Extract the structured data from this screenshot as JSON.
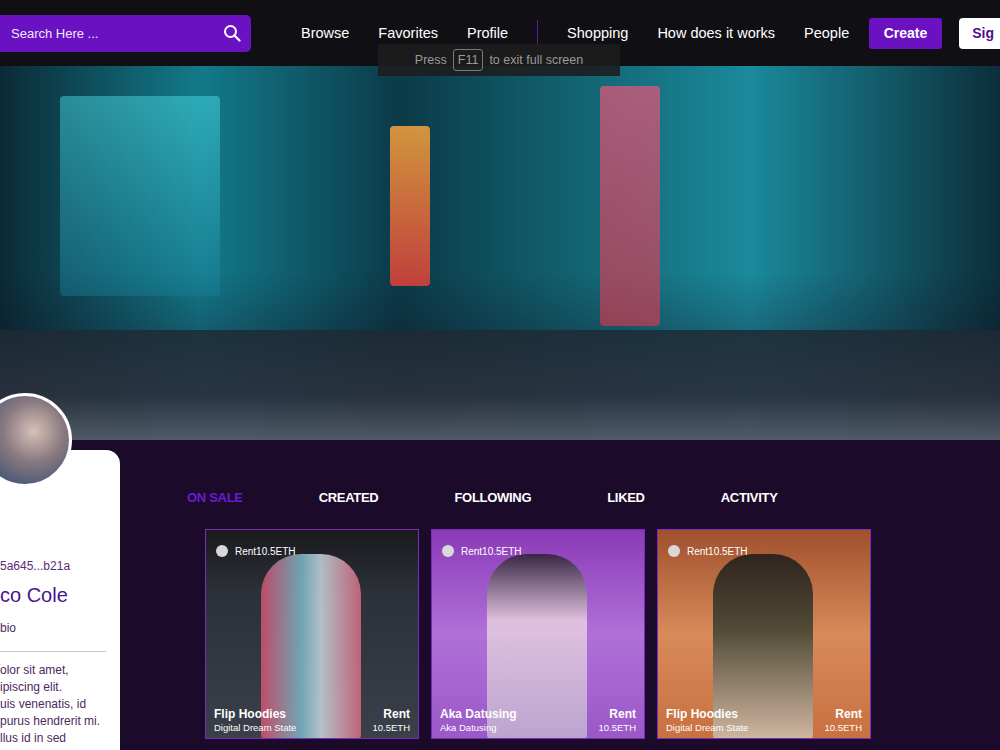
{
  "search": {
    "placeholder": "Search Here ..."
  },
  "nav": {
    "primary": [
      "Browse",
      "Favorites",
      "Profile"
    ],
    "secondary": [
      "Shopping",
      "How does it works",
      "People"
    ]
  },
  "buttons": {
    "create": "Create",
    "sign": "Sig"
  },
  "fullscreen_notice": {
    "before": "Press",
    "key": "F11",
    "after": "to exit full screen"
  },
  "profile": {
    "address": "5a645...b21a",
    "name": "co Cole",
    "bio_label": "bio",
    "bio_lines": [
      "olor sit amet,",
      "ipiscing elit.",
      "uis venenatis, id",
      "purus hendrerit mi.",
      "llus id in sed"
    ]
  },
  "tabs": [
    {
      "label": "ON SALE",
      "selected": true
    },
    {
      "label": "CREATED",
      "selected": false
    },
    {
      "label": "FOLLOWING",
      "selected": false
    },
    {
      "label": "LIKED",
      "selected": false
    },
    {
      "label": "ACTIVITY",
      "selected": false
    }
  ],
  "cards": [
    {
      "badge": "Rent10.5ETH",
      "title": "Flip Hoodies",
      "action": "Rent",
      "subtitle": "Digital Dream State",
      "price": "10.5ETH"
    },
    {
      "badge": "Rent10.5ETH",
      "title": "Aka Datusing",
      "action": "Rent",
      "subtitle": "Aka Datusing",
      "price": "10.5ETH"
    },
    {
      "badge": "Rent10.5ETH",
      "title": "Flip Hoodies",
      "action": "Rent",
      "subtitle": "Digital Dream State",
      "price": "10.5ETH"
    }
  ]
}
